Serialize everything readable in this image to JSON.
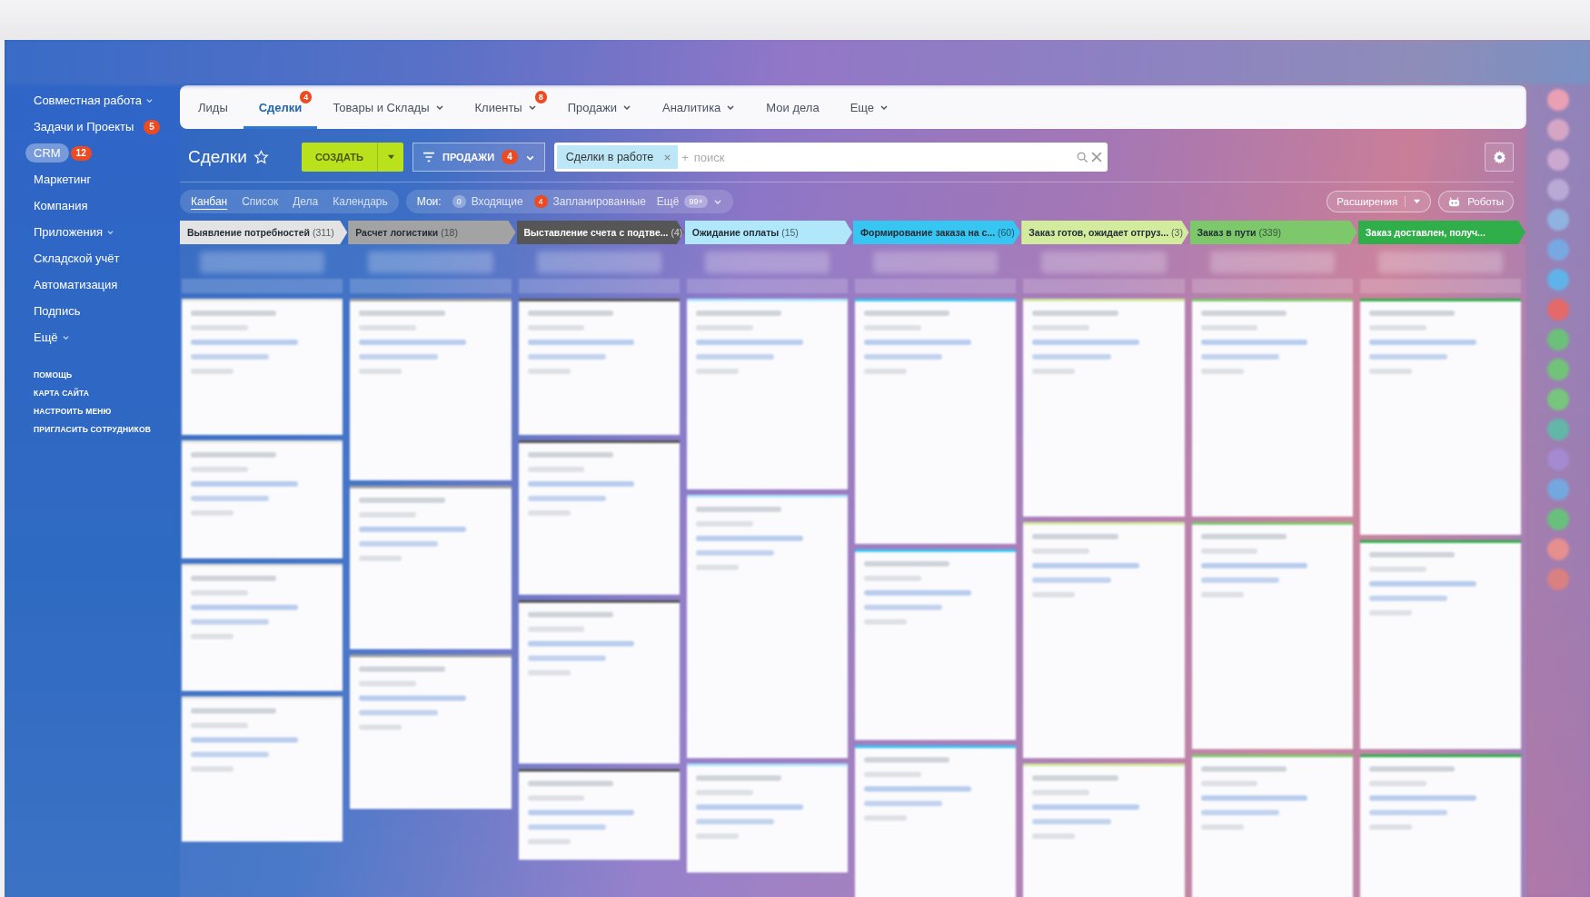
{
  "sidebar": {
    "items": [
      {
        "label": "Совместная работа",
        "dropdown": true,
        "selected": false
      },
      {
        "label": "Задачи и Проекты",
        "dropdown": false,
        "badge": "5",
        "selected": false
      },
      {
        "label": "CRM",
        "dropdown": false,
        "badge": "12",
        "selected": true
      },
      {
        "label": "Маркетинг",
        "dropdown": false,
        "selected": false
      },
      {
        "label": "Компания",
        "dropdown": false,
        "selected": false
      },
      {
        "label": "Приложения",
        "dropdown": true,
        "selected": false
      },
      {
        "label": "Складской учёт",
        "dropdown": false,
        "selected": false
      },
      {
        "label": "Автоматизация",
        "dropdown": false,
        "selected": false
      },
      {
        "label": "Подпись",
        "dropdown": false,
        "selected": false
      },
      {
        "label": "Ещё",
        "dropdown": true,
        "selected": false
      }
    ],
    "links": [
      "ПОМОЩЬ",
      "КАРТА САЙТА",
      "НАСТРОИТЬ МЕНЮ",
      "ПРИГЛАСИТЬ СОТРУДНИКОВ"
    ]
  },
  "nav": {
    "tabs": [
      {
        "label": "Лиды",
        "dropdown": false,
        "selected": false
      },
      {
        "label": "Сделки",
        "dropdown": false,
        "badge": "4",
        "selected": true
      },
      {
        "label": "Товары и Склады",
        "dropdown": true,
        "selected": false
      },
      {
        "label": "Клиенты",
        "dropdown": true,
        "badge": "8",
        "selected": false
      },
      {
        "label": "Продажи",
        "dropdown": true,
        "selected": false
      },
      {
        "label": "Аналитика",
        "dropdown": true,
        "selected": false
      },
      {
        "label": "Мои дела",
        "dropdown": false,
        "selected": false
      },
      {
        "label": "Еще",
        "dropdown": true,
        "selected": false
      }
    ]
  },
  "toolbar": {
    "title": "Сделки",
    "create_button": "СОЗДАТЬ",
    "filter_button": {
      "label": "ПРОДАЖИ",
      "badge": "4"
    },
    "search": {
      "chip": "Сделки в работе",
      "add": "+",
      "placeholder": "поиск"
    }
  },
  "views": {
    "tabs": [
      {
        "label": "Канбан",
        "selected": true
      },
      {
        "label": "Список",
        "selected": false
      },
      {
        "label": "Дела",
        "selected": false
      },
      {
        "label": "Календарь",
        "selected": false
      }
    ]
  },
  "counters": {
    "label": "Мои:",
    "items": [
      {
        "kind": "zero",
        "count": "0",
        "label": "Входящие"
      },
      {
        "kind": "alert",
        "count": "4",
        "label": "Запланированные"
      },
      {
        "kind": "more",
        "label": "Ещё",
        "count": "99+"
      }
    ]
  },
  "extensions_button": "Расширения",
  "robots_button": "Роботы",
  "stages": [
    {
      "name": "Выявление потребностей",
      "count": "(311)",
      "color": "#e3e3e3"
    },
    {
      "name": "Расчет логистики",
      "count": "(18)",
      "color": "#a3a3a3"
    },
    {
      "name": "Выставление счета с подтве...",
      "count": "(4)",
      "color": "#565656"
    },
    {
      "name": "Ожидание оплаты",
      "count": "(15)",
      "color": "#b0e7fa"
    },
    {
      "name": "Формирование заказа на с...",
      "count": "(60)",
      "color": "#37c5f2"
    },
    {
      "name": "Заказ готов, ожидает отгруз...",
      "count": "(3)",
      "color": "#d2eb9c"
    },
    {
      "name": "Заказ в пути",
      "count": "(339)",
      "color": "#7cc86a"
    },
    {
      "name": "Заказ доставлен, получ...",
      "color": "#2fae4a"
    }
  ]
}
